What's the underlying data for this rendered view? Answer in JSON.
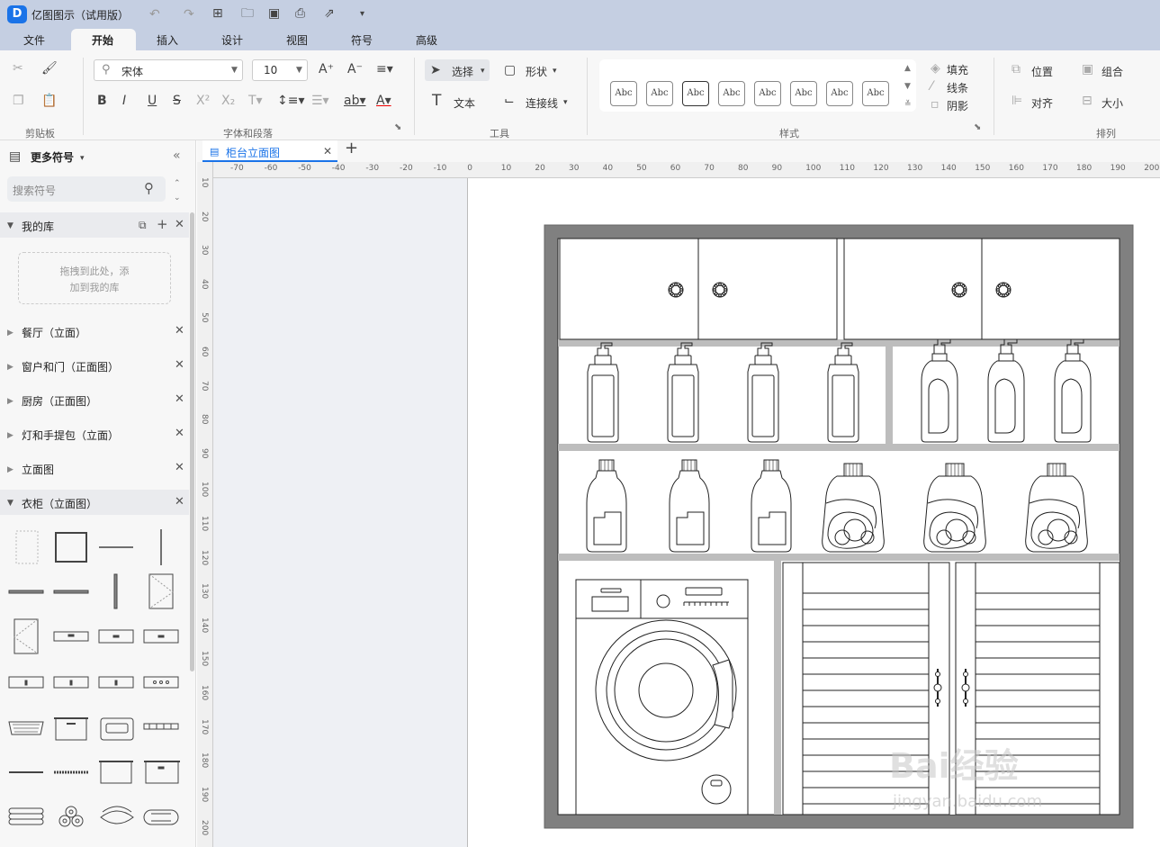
{
  "app": {
    "title": "亿图图示（试用版）",
    "logo_letter": "D"
  },
  "menu": [
    {
      "label": "文件"
    },
    {
      "label": "开始"
    },
    {
      "label": "插入"
    },
    {
      "label": "设计"
    },
    {
      "label": "视图"
    },
    {
      "label": "符号"
    },
    {
      "label": "高级"
    }
  ],
  "ribbon": {
    "groups": [
      "剪贴板",
      "字体和段落",
      "工具",
      "样式",
      "排列"
    ],
    "font_name": "宋体",
    "font_size": "10",
    "select_label": "选择",
    "shape_label": "形状",
    "text_label": "文本",
    "connector_label": "连接线",
    "style_sample": "Abc",
    "fill_label": "填充",
    "line_label": "线条",
    "shadow_label": "阴影",
    "position_label": "位置",
    "group_label": "组合",
    "align_label": "对齐",
    "size_label": "大小"
  },
  "sidebar": {
    "title": "更多符号",
    "search_placeholder": "搜索符号",
    "my_library": "我的库",
    "drop_hint_1": "拖拽到此处，添",
    "drop_hint_2": "加到我的库",
    "libraries": [
      {
        "label": "餐厅（立面）"
      },
      {
        "label": "窗户和门（正面图）"
      },
      {
        "label": "厨房（正面图）"
      },
      {
        "label": "灯和手提包（立面）"
      },
      {
        "label": "立面图"
      }
    ],
    "open_library": "衣柜（立面图）"
  },
  "document": {
    "tab_label": "柜台立面图"
  },
  "rulers": {
    "h_ticks": [
      "-70",
      "-60",
      "-50",
      "-40",
      "-30",
      "-20",
      "-10",
      "0",
      "10",
      "20",
      "30",
      "40",
      "50",
      "60",
      "70",
      "80",
      "90",
      "100",
      "110",
      "120",
      "130",
      "140",
      "150",
      "160",
      "170",
      "180",
      "190",
      "200"
    ],
    "v_ticks": [
      "10",
      "20",
      "30",
      "40",
      "50",
      "60",
      "70",
      "80",
      "90",
      "100",
      "110",
      "120",
      "130",
      "140",
      "150",
      "160",
      "170",
      "180",
      "190",
      "200"
    ]
  },
  "watermark": {
    "brand": "Bai经验",
    "url": "jingyan.baidu.com"
  },
  "colors": {
    "titlebar": "#c5cfe2",
    "accent": "#1a73e8",
    "frame": "#808080",
    "shelf": "#bdbdbd"
  }
}
